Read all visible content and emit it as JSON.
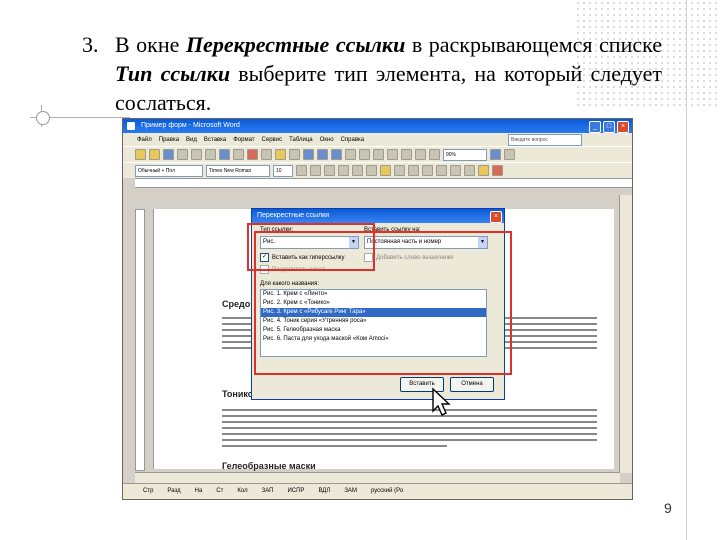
{
  "slide": {
    "item_number": "3.",
    "text_intro": "В окне",
    "text_dialog_name": "Перекрестные ссылки",
    "text_mid": "в раскрывающемся списке",
    "text_field_name": "Тип ссылки",
    "text_end": "выберите тип элемента, на который следует сослаться.",
    "page_number": "9"
  },
  "word": {
    "title": "Пример форм - Microsoft Word",
    "menu": [
      "Файл",
      "Правка",
      "Вид",
      "Вставка",
      "Формат",
      "Сервис",
      "Таблица",
      "Окно",
      "Справка"
    ],
    "search_placeholder": "Введите вопрос",
    "zoom": "90%",
    "style": "Обычный + Пол",
    "font": "Times New Roman",
    "font_size": "10",
    "doc_heading_1": "Средо",
    "doc_heading_2": "Тонико",
    "doc_heading_3": "Гелеобразные маски",
    "status": [
      "Стр",
      "Разд",
      "",
      "На",
      "Ст",
      "Кол",
      "ЗАП",
      "ИСПР",
      "ВДЛ",
      "ЗАМ",
      "русский (Ро"
    ]
  },
  "dialog": {
    "title": "Перекрестные ссылки",
    "close": "×",
    "ref_type_label": "Тип ссылки:",
    "ref_type_value": "Рис.",
    "insert_ref_label": "Вставить ссылку на:",
    "insert_ref_value": "Постоянная часть и номер",
    "hyperlink_label": "Вставить как гиперссылку",
    "above_below_label": "Добавить слово выше/ниже",
    "separator_label": "Разделитель чисел",
    "which_label": "Для какого названия:",
    "items": [
      "Рис. 1. Крем с «Линто»",
      "Рис. 2. Крем с «Тонико»",
      "Рис. 3. Крем с «Рибусаге Ринг Тара»",
      "Рис. 4. Тоник серия «Утренняя роса»",
      "Рис. 5. Гелеобразная маска",
      "Рис. 6. Паста для ухода маской «Ком Amoci»"
    ],
    "selected_index": 2,
    "insert_button": "Вставить",
    "cancel_button": "Отмена"
  }
}
